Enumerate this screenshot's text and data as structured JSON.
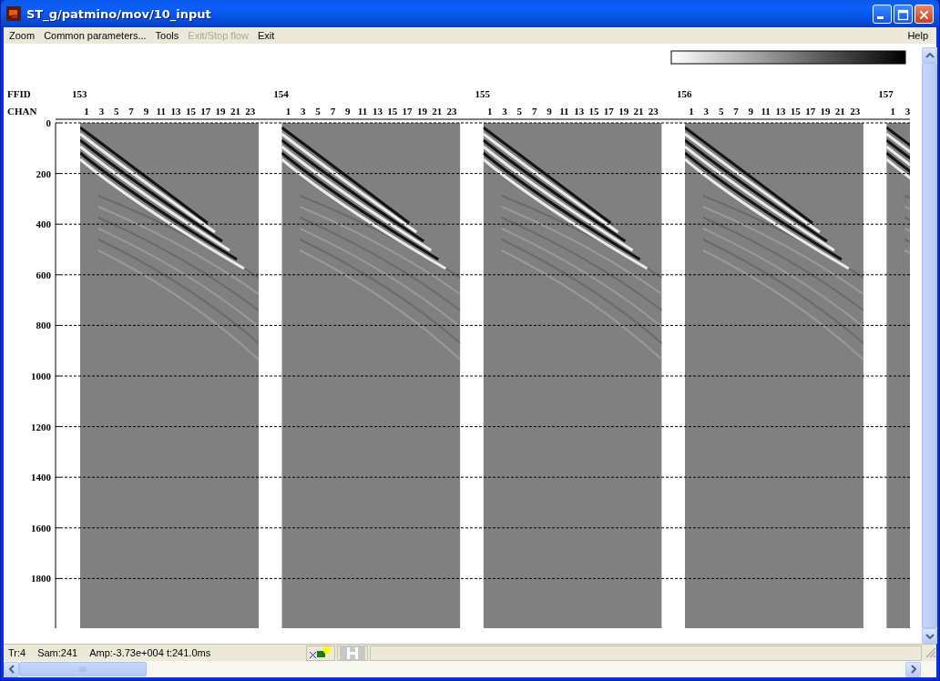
{
  "window": {
    "title": "ST_g/patmino/mov/10_input"
  },
  "menu": {
    "items": [
      {
        "label": "Zoom",
        "disabled": false
      },
      {
        "label": "Common parameters...",
        "disabled": false
      },
      {
        "label": "Tools",
        "disabled": false
      },
      {
        "label": "Exit/Stop flow",
        "disabled": true
      },
      {
        "label": "Exit",
        "disabled": false
      }
    ],
    "right_items": [
      {
        "label": "Help",
        "disabled": false
      }
    ]
  },
  "plot": {
    "ffid_label": "FFID",
    "chan_label": "CHAN",
    "gathers": [
      {
        "ffid": "153",
        "channels": [
          "1",
          "3",
          "5",
          "7",
          "9",
          "11",
          "13",
          "15",
          "17",
          "19",
          "21",
          "23"
        ]
      },
      {
        "ffid": "154",
        "channels": [
          "1",
          "3",
          "5",
          "7",
          "9",
          "11",
          "13",
          "15",
          "17",
          "19",
          "21",
          "23"
        ]
      },
      {
        "ffid": "155",
        "channels": [
          "1",
          "3",
          "5",
          "7",
          "9",
          "11",
          "13",
          "15",
          "17",
          "19",
          "21",
          "23"
        ]
      },
      {
        "ffid": "156",
        "channels": [
          "1",
          "3",
          "5",
          "7",
          "9",
          "11",
          "13",
          "15",
          "17",
          "19",
          "21",
          "23"
        ]
      },
      {
        "ffid": "157",
        "channels": [
          "1",
          "3"
        ]
      }
    ],
    "time_ticks": [
      "0",
      "200",
      "400",
      "600",
      "800",
      "1000",
      "1200",
      "1400",
      "1600",
      "1800"
    ]
  },
  "status_bar": {
    "trace": "Tr:4",
    "sample": "Sam:241",
    "amplitude": "Amp:-3.73e+004 t:241.0ms"
  }
}
